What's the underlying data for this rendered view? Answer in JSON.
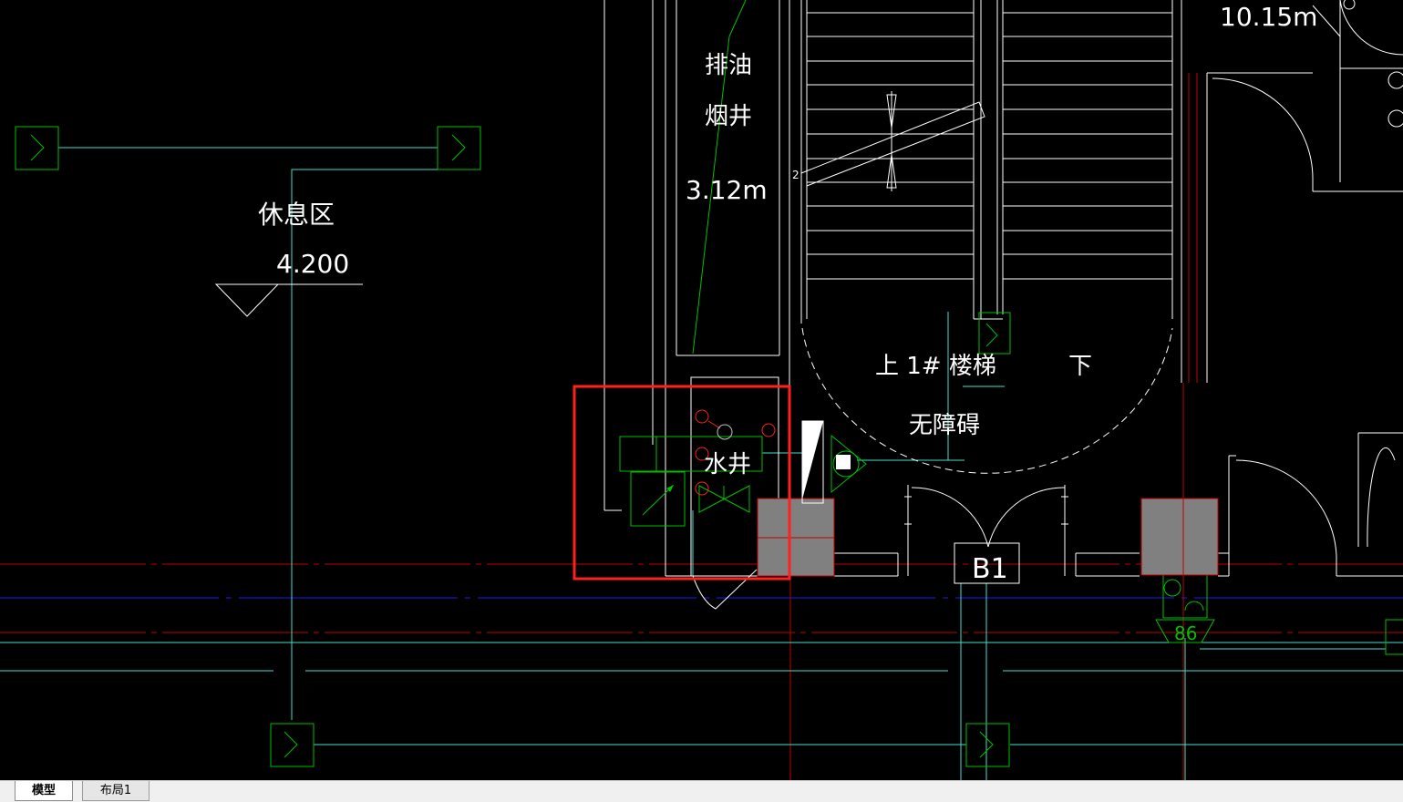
{
  "drawing": {
    "labels": {
      "rest_area": "休息区",
      "elevation": "4.200",
      "exhaust_line1": "排油",
      "exhaust_line2": "烟井",
      "exhaust_size": "3.12m",
      "top_dimension": "10.15m",
      "stair_up": "上 1# 楼梯",
      "stair_down": "下",
      "accessible": "无障碍",
      "water_well": "水井",
      "axis_b1": "B1",
      "stair_mark": "2",
      "fixture_code": "86"
    },
    "colors": {
      "background": "#000000",
      "cyan": "#40e0d0",
      "green": "#00c000",
      "white": "#ffffff",
      "red_axis": "#c00000",
      "blue_axis": "#0000ff",
      "highlight": "#ff2020",
      "fill_gray": "#808080"
    }
  },
  "tabs": [
    {
      "label": "模型",
      "active": true
    },
    {
      "label": "布局1",
      "active": false
    }
  ]
}
